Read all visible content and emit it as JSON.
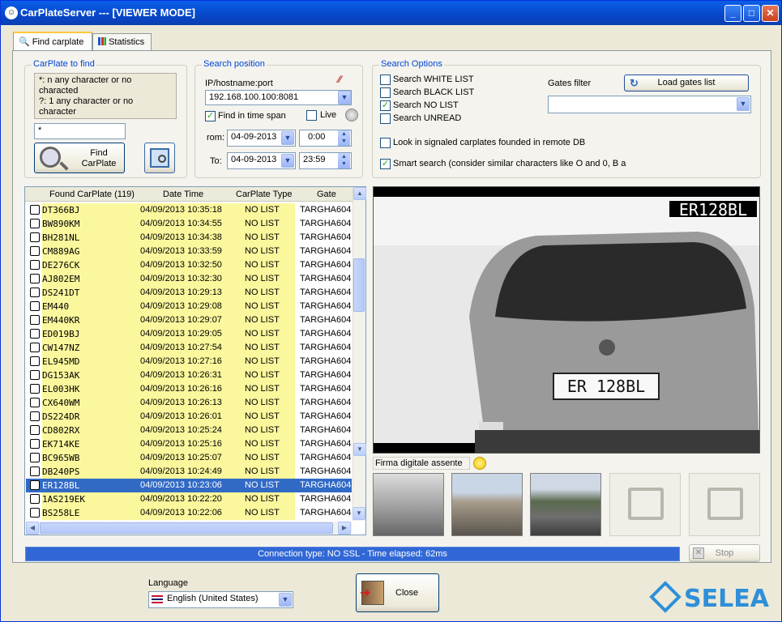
{
  "window": {
    "title": "CarPlateServer --- [VIEWER MODE]"
  },
  "tabs": [
    {
      "label": "Find carplate"
    },
    {
      "label": "Statistics"
    }
  ],
  "carplate_group": {
    "legend": "CarPlate to find",
    "hint_lines": [
      "*: n any character or no characted",
      "?: 1 any character or no character"
    ],
    "input_value": "*",
    "find_button": "Find\nCarPlate"
  },
  "search_position": {
    "legend": "Search position",
    "ip_label": "IP/hostname:port",
    "ip_value": "192.168.100.100:8081",
    "find_in_timespan": "Find in time span",
    "live_label": "Live",
    "from_label": "rom:",
    "from_date": "04-09-2013",
    "from_time": "0:00",
    "to_label": "To:",
    "to_date": "04-09-2013",
    "to_time": "23:59"
  },
  "search_options": {
    "legend": "Search Options",
    "white": "Search WHITE LIST",
    "black": "Search BLACK LIST",
    "nolist": "Search NO LIST",
    "unread": "Search UNREAD",
    "gates_filter": "Gates filter",
    "load_gates": "Load gates list",
    "remote_db": "Look in signaled carplates founded in remote DB",
    "smart": "Smart search (consider similar characters like O and 0, B a"
  },
  "grid": {
    "headers": [
      "Found CarPlate (119)",
      "Date Time",
      "CarPlate Type",
      "Gate"
    ],
    "rows": [
      [
        "DT366BJ",
        "04/09/2013 10:35:18",
        "NO LIST",
        "TARGHA604"
      ],
      [
        "BW890KM",
        "04/09/2013 10:34:55",
        "NO LIST",
        "TARGHA604"
      ],
      [
        "BH281NL",
        "04/09/2013 10:34:38",
        "NO LIST",
        "TARGHA604"
      ],
      [
        "CM889AG",
        "04/09/2013 10:33:59",
        "NO LIST",
        "TARGHA604"
      ],
      [
        "DE276CK",
        "04/09/2013 10:32:50",
        "NO LIST",
        "TARGHA604"
      ],
      [
        "AJ802EM",
        "04/09/2013 10:32:30",
        "NO LIST",
        "TARGHA604"
      ],
      [
        "DS241DT",
        "04/09/2013 10:29:13",
        "NO LIST",
        "TARGHA604"
      ],
      [
        "EM440",
        "04/09/2013 10:29:08",
        "NO LIST",
        "TARGHA604"
      ],
      [
        "EM440KR",
        "04/09/2013 10:29:07",
        "NO LIST",
        "TARGHA604"
      ],
      [
        "ED019BJ",
        "04/09/2013 10:29:05",
        "NO LIST",
        "TARGHA604"
      ],
      [
        "CW147NZ",
        "04/09/2013 10:27:54",
        "NO LIST",
        "TARGHA604"
      ],
      [
        "EL945MD",
        "04/09/2013 10:27:16",
        "NO LIST",
        "TARGHA604"
      ],
      [
        "DG153AK",
        "04/09/2013 10:26:31",
        "NO LIST",
        "TARGHA604"
      ],
      [
        "EL003HK",
        "04/09/2013 10:26:16",
        "NO LIST",
        "TARGHA604"
      ],
      [
        "CX640WM",
        "04/09/2013 10:26:13",
        "NO LIST",
        "TARGHA604"
      ],
      [
        "DS224DR",
        "04/09/2013 10:26:01",
        "NO LIST",
        "TARGHA604"
      ],
      [
        "CD802RX",
        "04/09/2013 10:25:24",
        "NO LIST",
        "TARGHA604"
      ],
      [
        "EK714KE",
        "04/09/2013 10:25:16",
        "NO LIST",
        "TARGHA604"
      ],
      [
        "BC965WB",
        "04/09/2013 10:25:07",
        "NO LIST",
        "TARGHA604"
      ],
      [
        "DB240PS",
        "04/09/2013 10:24:49",
        "NO LIST",
        "TARGHA604"
      ],
      [
        "ER128BL",
        "04/09/2013 10:23:06",
        "NO LIST",
        "TARGHA604"
      ],
      [
        "1AS219EK",
        "04/09/2013 10:22:20",
        "NO LIST",
        "TARGHA604"
      ],
      [
        "BS258LE",
        "04/09/2013 10:22:06",
        "NO LIST",
        "TARGHA604"
      ]
    ],
    "selected_index": 20
  },
  "viewer": {
    "overlay_plate": "ER128BL",
    "car_plate": "ER 128BL",
    "signature_label": "Firma digitale assente"
  },
  "status": {
    "connection": "Connection type: NO SSL - Time elapsed: 62ms",
    "stop_button": "Stop"
  },
  "footer": {
    "language_label": "Language",
    "language_value": "English (United States)",
    "close_button": "Close",
    "brand": "SELEA"
  }
}
